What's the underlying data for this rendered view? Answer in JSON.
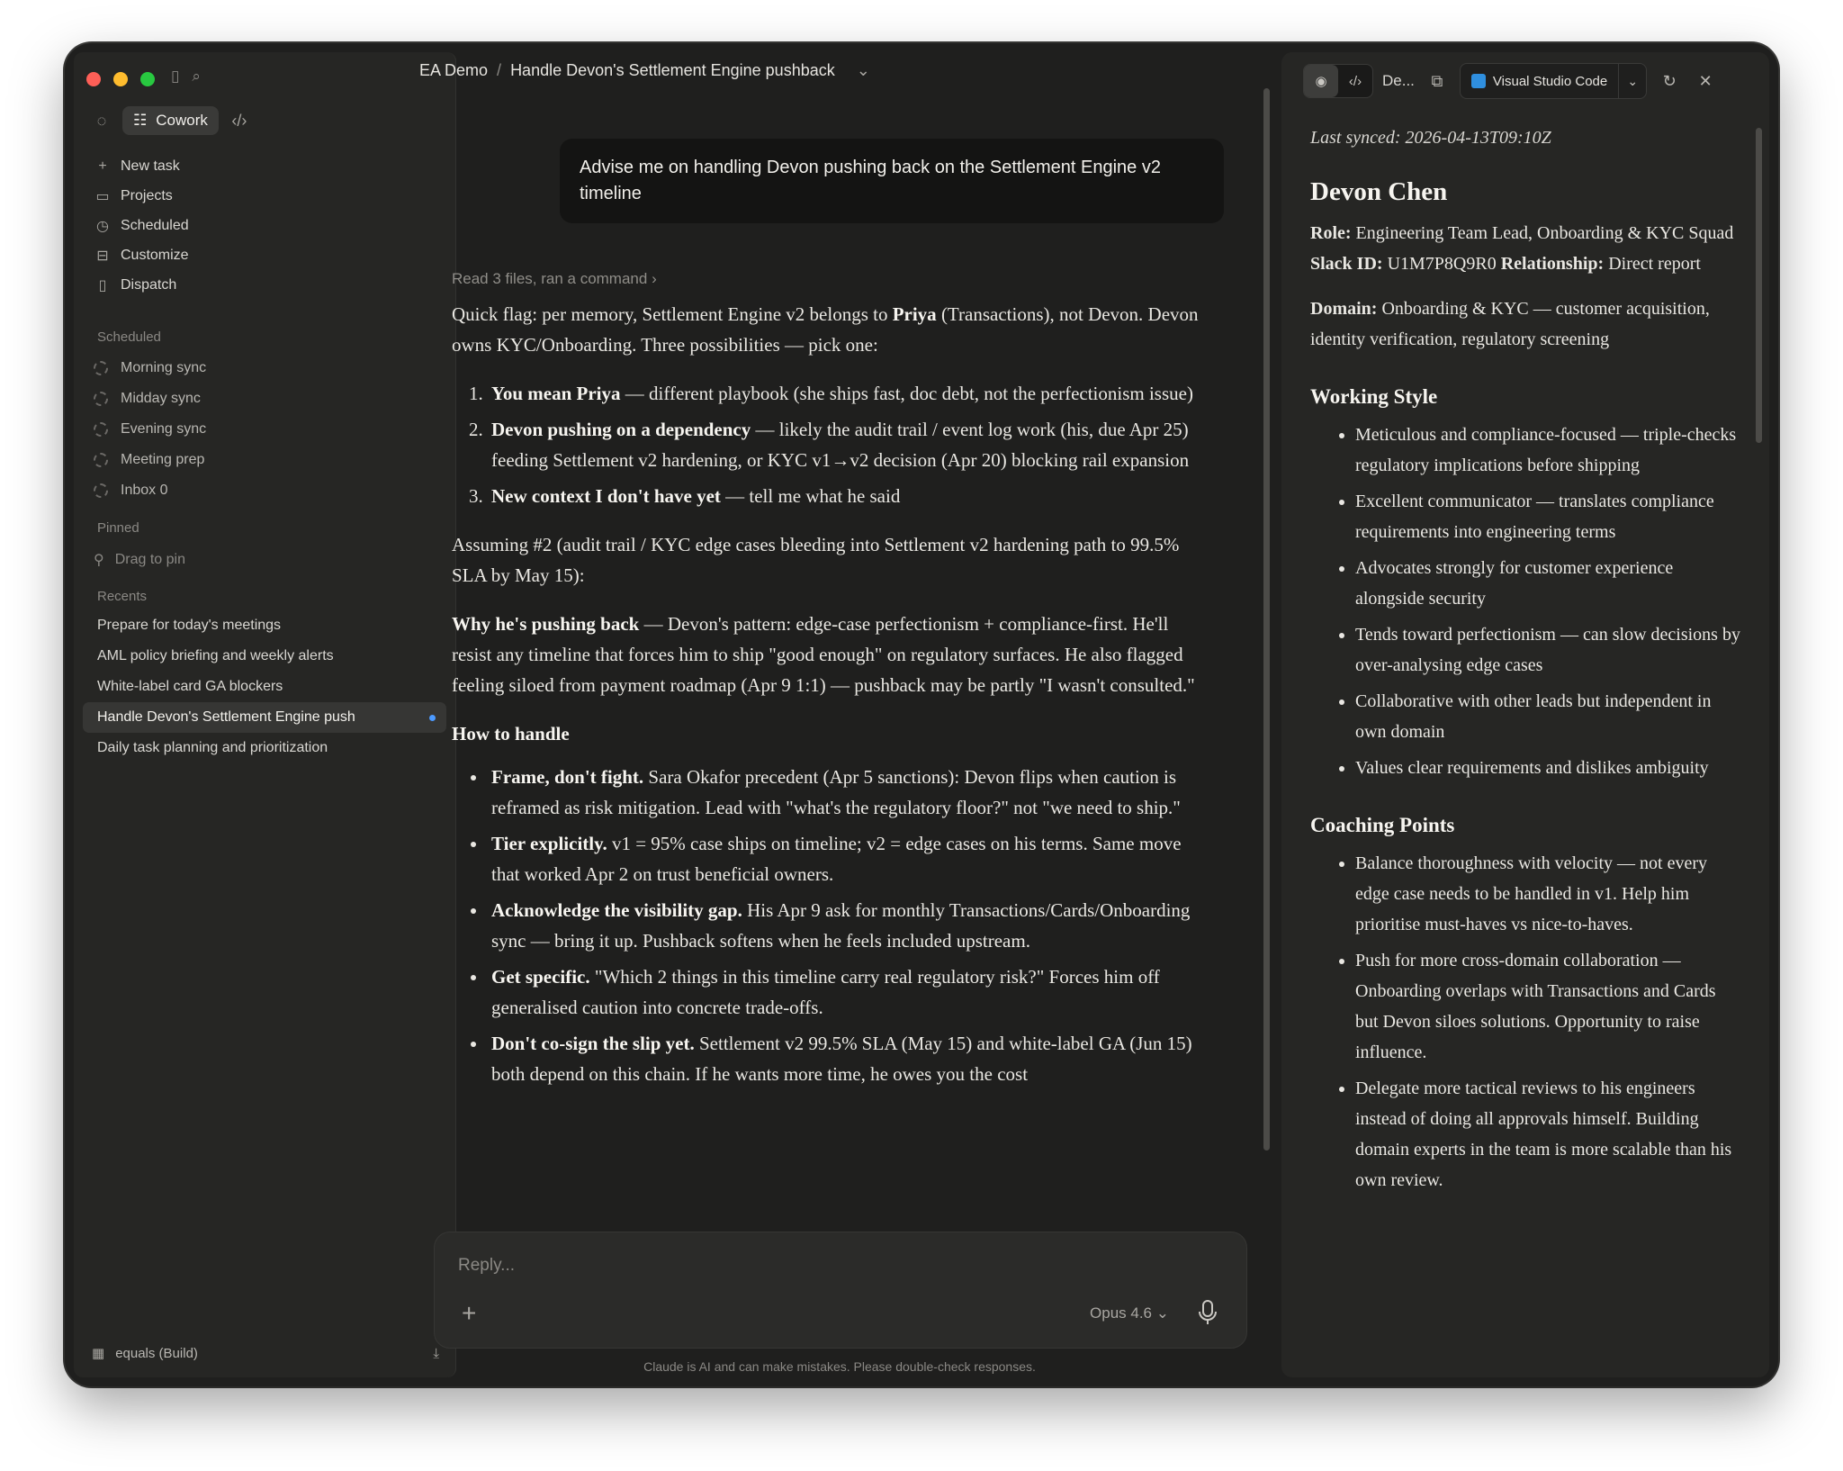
{
  "sidebar": {
    "mode_label": "Cowork",
    "nav": [
      {
        "label": "New task",
        "icon": "plus-icon"
      },
      {
        "label": "Projects",
        "icon": "folder-icon"
      },
      {
        "label": "Scheduled",
        "icon": "clock-icon"
      },
      {
        "label": "Customize",
        "icon": "briefcase-icon"
      },
      {
        "label": "Dispatch",
        "icon": "phone-icon"
      }
    ],
    "scheduled_label": "Scheduled",
    "scheduled": [
      "Morning sync",
      "Midday sync",
      "Evening sync",
      "Meeting prep",
      "Inbox 0"
    ],
    "pinned_label": "Pinned",
    "pin_hint": "Drag to pin",
    "recents_label": "Recents",
    "recents": [
      "Prepare for today's meetings",
      "AML policy briefing and weekly alerts",
      "White-label card GA blockers",
      "Handle Devon's Settlement Engine push",
      "Daily task planning and prioritization"
    ],
    "footer": "equals (Build)"
  },
  "breadcrumb": {
    "project": "EA Demo",
    "separator": "/",
    "title": "Handle Devon's Settlement Engine pushback"
  },
  "chat": {
    "user_message": "Advise me on handling Devon pushing back on the Settlement Engine v2 timeline",
    "tool_summary": "Read 3 files, ran a command",
    "intro_1": "Quick flag: per memory, Settlement Engine v2 belongs to ",
    "intro_bold": "Priya",
    "intro_2": " (Transactions), not Devon. Devon owns KYC/Onboarding. Three possibilities — pick one:",
    "options": [
      {
        "bold": "You mean Priya",
        "text": " — different playbook (she ships fast, doc debt, not the perfectionism issue)"
      },
      {
        "bold": "Devon pushing on a dependency",
        "text": " — likely the audit trail / event log work (his, due Apr 25) feeding Settlement v2 hardening, or KYC v1→v2 decision (Apr 20) blocking rail expansion"
      },
      {
        "bold": "New context I don't have yet",
        "text": " — tell me what he said"
      }
    ],
    "assumption": "Assuming #2 (audit trail / KYC edge cases bleeding into Settlement v2 hardening path to 99.5% SLA by May 15):",
    "why_bold": "Why he's pushing back",
    "why_text": " — Devon's pattern: edge-case perfectionism + compliance-first. He'll resist any timeline that forces him to ship \"good enough\" on regulatory surfaces. He also flagged feeling siloed from payment roadmap (Apr 9 1:1) — pushback may be partly \"I wasn't consulted.\"",
    "how_heading": "How to handle",
    "tactics": [
      {
        "bold": "Frame, don't fight.",
        "text": " Sara Okafor precedent (Apr 5 sanctions): Devon flips when caution is reframed as risk mitigation. Lead with \"what's the regulatory floor?\" not \"we need to ship.\""
      },
      {
        "bold": "Tier explicitly.",
        "text": " v1 = 95% case ships on timeline; v2 = edge cases on his terms. Same move that worked Apr 2 on trust beneficial owners."
      },
      {
        "bold": "Acknowledge the visibility gap.",
        "text": " His Apr 9 ask for monthly Transactions/Cards/Onboarding sync — bring it up. Pushback softens when he feels included upstream."
      },
      {
        "bold": "Get specific.",
        "text": " \"Which 2 things in this timeline carry real regulatory risk?\" Forces him off generalised caution into concrete trade-offs."
      },
      {
        "bold": "Don't co-sign the slip yet.",
        "text": " Settlement v2 99.5% SLA (May 15) and white-label GA (Jun 15) both depend on this chain. If he wants more time, he owes you the cost"
      }
    ],
    "reply_placeholder": "Reply...",
    "model": "Opus 4.6",
    "disclaimer": "Claude is AI and can make mistakes. Please double-check responses."
  },
  "panel": {
    "doc_tab": "De...",
    "open_in": "Visual Studio Code",
    "last_synced": "Last synced: 2026-04-13T09:10Z",
    "name": "Devon Chen",
    "role_label": "Role:",
    "role": " Engineering Team Lead, Onboarding & KYC Squad ",
    "slack_label": "Slack ID:",
    "slack": " U1M7P8Q9R0 ",
    "relationship_label": "Relationship:",
    "relationship": " Direct report",
    "domain_label": "Domain:",
    "domain": " Onboarding & KYC — customer acquisition, identity verification, regulatory screening",
    "working_style_heading": "Working Style",
    "working_style": [
      "Meticulous and compliance-focused — triple-checks regulatory implications before shipping",
      "Excellent communicator — translates compliance requirements into engineering terms",
      "Advocates strongly for customer experience alongside security",
      "Tends toward perfectionism — can slow decisions by over-analysing edge cases",
      "Collaborative with other leads but independent in own domain",
      "Values clear requirements and dislikes ambiguity"
    ],
    "coaching_heading": "Coaching Points",
    "coaching": [
      "Balance thoroughness with velocity — not every edge case needs to be handled in v1. Help him prioritise must-haves vs nice-to-haves.",
      "Push for more cross-domain collaboration — Onboarding overlaps with Transactions and Cards but Devon siloes solutions. Opportunity to raise influence.",
      "Delegate more tactical reviews to his engineers instead of doing all approvals himself. Building domain experts in the team is more scalable than his own review."
    ]
  }
}
